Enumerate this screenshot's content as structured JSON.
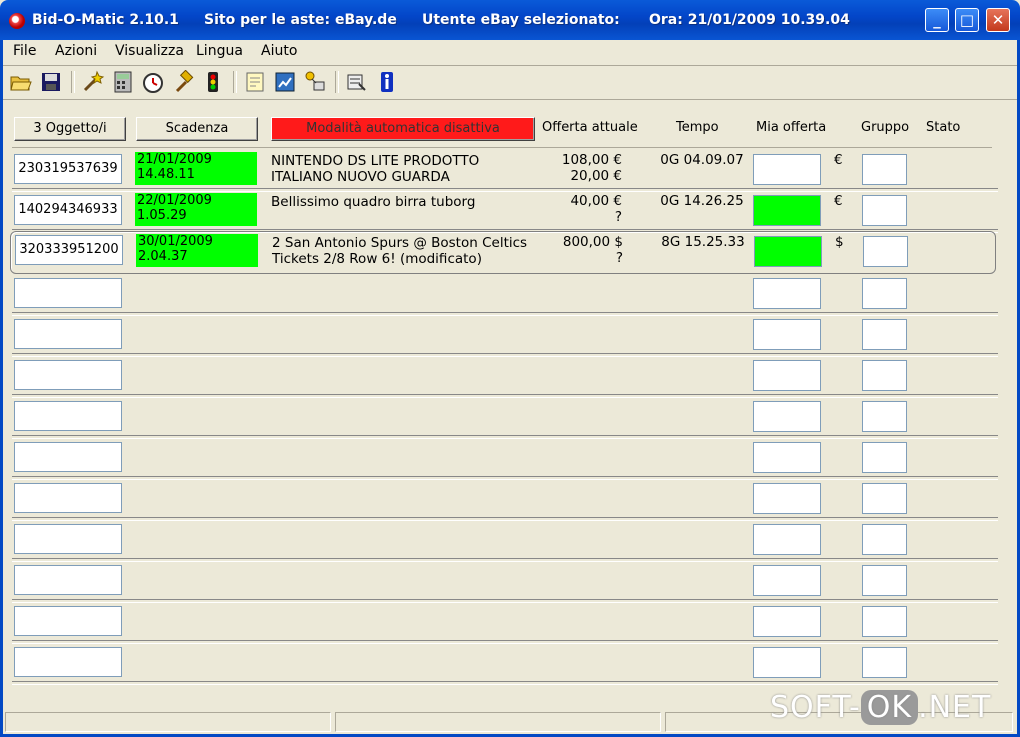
{
  "window": {
    "app_title": "Bid-O-Matic 2.10.1",
    "site_label": "Sito per le aste: eBay.de",
    "user_label": "Utente eBay selezionato:",
    "time_label": "Ora: 21/01/2009 10.39.04",
    "minimize_glyph": "_",
    "maximize_glyph": "□",
    "close_glyph": "✕"
  },
  "menu": [
    "File",
    "Azioni",
    "Visualizza",
    "Lingua",
    "Aiuto"
  ],
  "toolbar_icons": [
    "open-folder-icon",
    "save-icon",
    "wizard-icon",
    "calculator-icon",
    "clock-icon",
    "hammer-icon",
    "traffic-light-icon",
    "document-icon",
    "chart-icon",
    "network-icon",
    "settings-icon",
    "info-icon"
  ],
  "header": {
    "items_button": "3 Oggetto/i",
    "expiry_button": "Scadenza",
    "auto_mode_button": "Modalità automatica disattiva",
    "col_current_offer": "Offerta attuale",
    "col_time": "Tempo",
    "col_my_offer": "Mia offerta",
    "col_group": "Gruppo",
    "col_status": "Stato"
  },
  "rows": [
    {
      "id": "230319537639",
      "exp_date": "21/01/2009",
      "exp_time": "14.48.11",
      "title": "NINTENDO DS LITE  PRODOTTO ITALIANO  NUOVO GUARDA",
      "price1": "108,00 €",
      "price2": "20,00 €",
      "time": "0G 04.09.07",
      "currency": "€"
    },
    {
      "id": "140294346933",
      "exp_date": "22/01/2009",
      "exp_time": "1.05.29",
      "title": "Bellissimo quadro birra tuborg",
      "price1": "40,00 €",
      "price2": "?",
      "time": "0G 14.26.25",
      "currency": "€"
    },
    {
      "id": "320333951200",
      "exp_date": "30/01/2009",
      "exp_time": "2.04.37",
      "title": "2 San Antonio Spurs @ Boston Celtics Tickets 2/8 Row 6! (modificato)",
      "price1": "800,00 $",
      "price2": "?",
      "time": "8G 15.25.33",
      "currency": "$"
    }
  ],
  "watermark": {
    "pre": "SOFT-",
    "mid": "OK",
    "post": ".NET"
  },
  "colors": {
    "expiry_bg": "#00ff00",
    "auto_off": "#ff1a1a",
    "titlebar": "#0346c9"
  }
}
